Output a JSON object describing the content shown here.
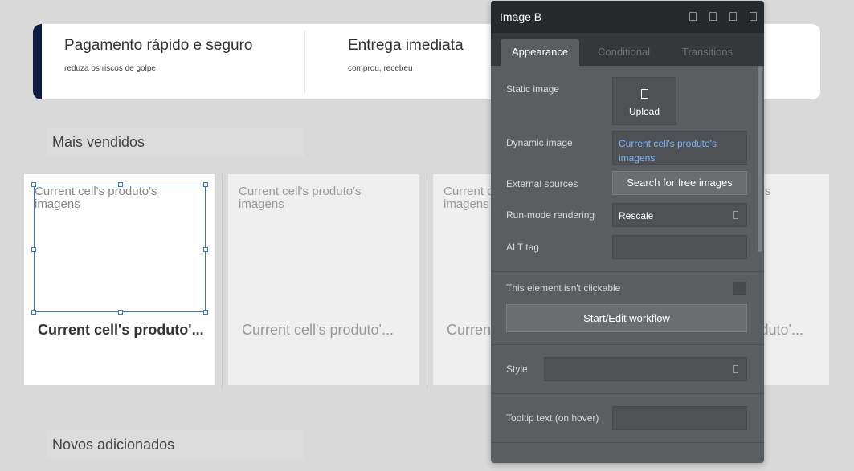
{
  "banner": {
    "features": [
      {
        "title": "Pagamento rápido e seguro",
        "subtitle": "reduza os riscos de golpe"
      },
      {
        "title": "Entrega imediata",
        "subtitle": "comprou, recebeu"
      }
    ]
  },
  "sections": {
    "best_sellers": "Mais vendidos",
    "new_added": "Novos adicionados"
  },
  "cards": [
    {
      "image_text": "Current cell's produto's imagens",
      "name": "Current cell's produto'..."
    },
    {
      "image_text": "Current cell's produto's imagens",
      "name": "Current cell's produto'..."
    },
    {
      "image_text": "Current cell's produto's imagens",
      "name": "Current cell's produto'..."
    },
    {
      "image_text": "Current cell's produto's imagens",
      "name": "Current cell's produto'..."
    }
  ],
  "panel": {
    "title": "Image B",
    "tabs": [
      "Appearance",
      "Conditional",
      "Transitions"
    ],
    "static_image_label": "Static image",
    "upload_label": "Upload",
    "dynamic_image_label": "Dynamic image",
    "dynamic_image_value": "Current cell's produto's imagens",
    "external_sources_label": "External sources",
    "search_button": "Search for free images",
    "run_mode_label": "Run-mode rendering",
    "run_mode_value": "Rescale",
    "alt_tag_label": "ALT tag",
    "alt_tag_value": "",
    "not_clickable_label": "This element isn't clickable",
    "workflow_button": "Start/Edit workflow",
    "style_label": "Style",
    "style_value": "",
    "tooltip_label": "Tooltip text (on hover)",
    "tooltip_value": ""
  },
  "colors": {
    "accent": "#0e1c44",
    "panel_bg": "#5b5e61",
    "panel_header": "#262a2c",
    "selection": "#3b73c4",
    "link": "#7fb3ff"
  }
}
